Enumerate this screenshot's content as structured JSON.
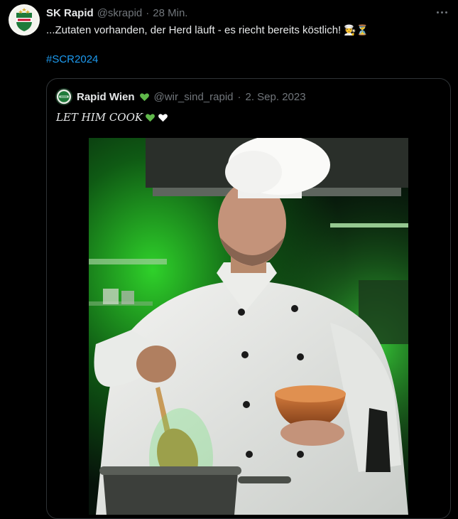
{
  "tweet": {
    "display_name": "SK Rapid",
    "handle": "@skrapid",
    "separator": "·",
    "time": "28 Min.",
    "text": "...Zutaten vorhanden, der Herd läuft - es riecht bereits köstlich!",
    "text_emojis": "🧑‍🍳⏳",
    "hashtag": "#SCR2024",
    "avatar_icon": "sk-rapid-crest"
  },
  "quote": {
    "display_name": "Rapid Wien",
    "handle": "@wir_sind_rapid",
    "separator": "·",
    "date": "2. Sep. 2023",
    "text": "LET HIM COOK",
    "name_icon": "green-heart-icon",
    "text_icons": [
      "green-heart-icon",
      "white-heart-icon"
    ],
    "media_description": "photo",
    "colors": {
      "green_heart": "#5fb84a",
      "white_heart": "#ffffff",
      "link": "#1d9bf0"
    }
  }
}
